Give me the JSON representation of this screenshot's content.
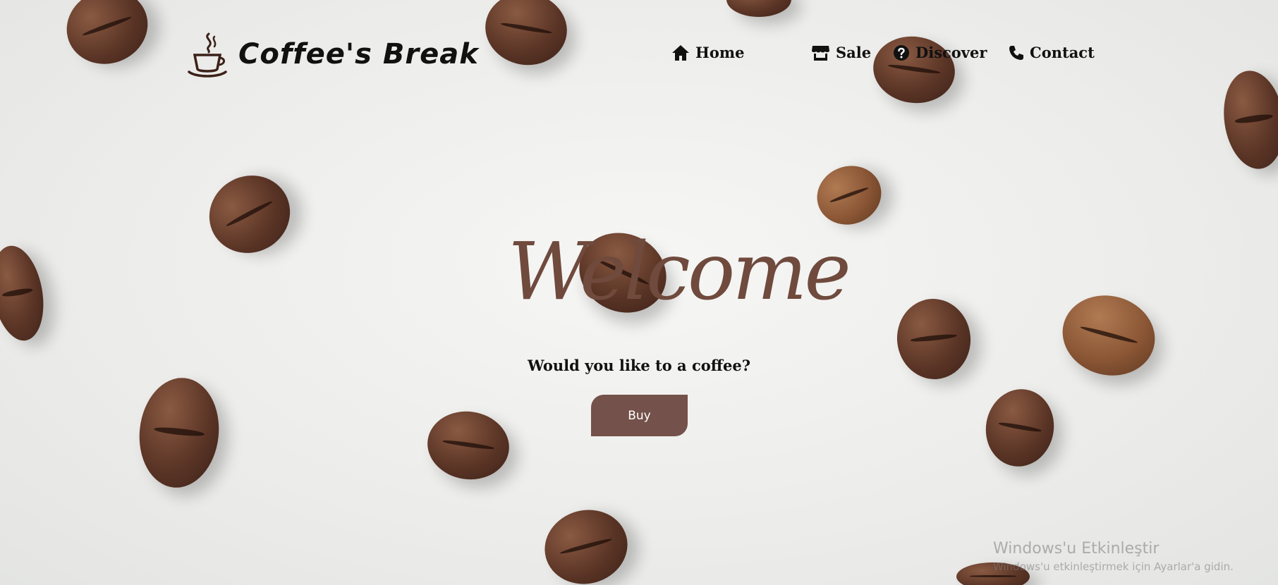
{
  "brand": {
    "name": "Coffee's Break",
    "logo_icon": "coffee-cup-icon"
  },
  "nav": {
    "items": [
      {
        "label": "Home",
        "icon": "home-icon"
      },
      {
        "label": "Sale",
        "icon": "store-icon"
      },
      {
        "label": "Discover",
        "icon": "question-circle-icon"
      },
      {
        "label": "Contact",
        "icon": "phone-icon"
      }
    ]
  },
  "hero": {
    "title": "Welcome",
    "subtitle": "Would you like to a coffee?",
    "button_label": "Buy"
  },
  "watermark": {
    "title": "Windows'u Etkinleştir",
    "subtitle": "Windows'u etkinleştirmek için Ayarlar'a gidin."
  },
  "colors": {
    "accent": "#74514a",
    "welcome_text": "#6f4a3d",
    "background": "#ececea"
  }
}
